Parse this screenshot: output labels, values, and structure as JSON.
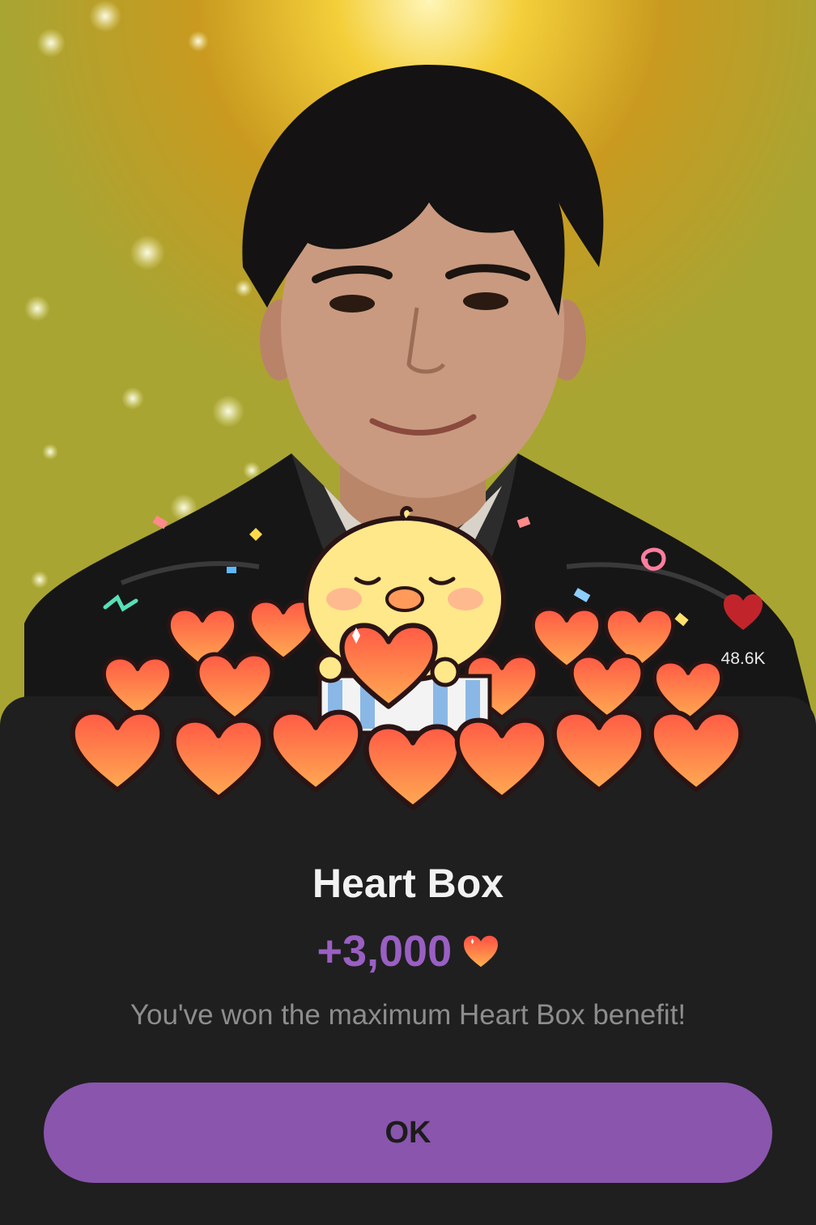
{
  "dialog": {
    "title": "Heart Box",
    "reward_amount": "+3,000",
    "message": "You've won the maximum Heart Box benefit!",
    "ok_label": "OK"
  },
  "profile": {
    "like_count": "48.6K"
  },
  "colors": {
    "accent": "#8a55ad",
    "reward_text": "#9a5fc3",
    "sheet_bg": "#1f1f1f",
    "heart": "#f2553e"
  },
  "icons": [
    "heart-icon",
    "reward-heart-icon",
    "chick-character-icon"
  ]
}
